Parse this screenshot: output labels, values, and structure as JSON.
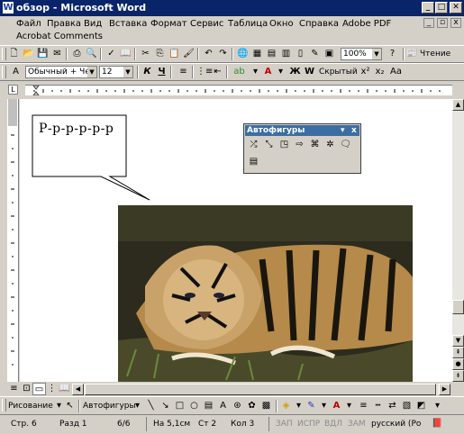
{
  "window": {
    "title": "обзор - Microsoft Word"
  },
  "menu": {
    "items": [
      "Файл",
      "Правка",
      "Вид",
      "Вставка",
      "Формат",
      "Сервис",
      "Таблица",
      "Окно",
      "Справка",
      "Adobe PDF"
    ],
    "second_row": "Acrobat Comments"
  },
  "standard_toolbar": {
    "zoom": "100%",
    "read_label": "Чтение"
  },
  "formatting_toolbar": {
    "style": "Обычный + Чер",
    "size": "12",
    "bold": "Ж",
    "italic": "К",
    "underline": "Ч",
    "hidden_label": "Скрытый"
  },
  "document": {
    "callout_text": "Р-р-р-р-р-р"
  },
  "autoshapes_toolbar": {
    "title": "Автофигуры"
  },
  "drawing_toolbar": {
    "draw_label": "Рисование",
    "autoshapes_label": "Автофигуры"
  },
  "status_bar": {
    "page": "Стр. 6",
    "section": "Разд 1",
    "pages": "6/6",
    "at": "На 5,1см",
    "line": "Ст 2",
    "col": "Кол 3",
    "rec": "ЗАП",
    "trk": "ИСПР",
    "ext": "ВДЛ",
    "ovr": "ЗАМ",
    "lang": "русский (Ро"
  }
}
